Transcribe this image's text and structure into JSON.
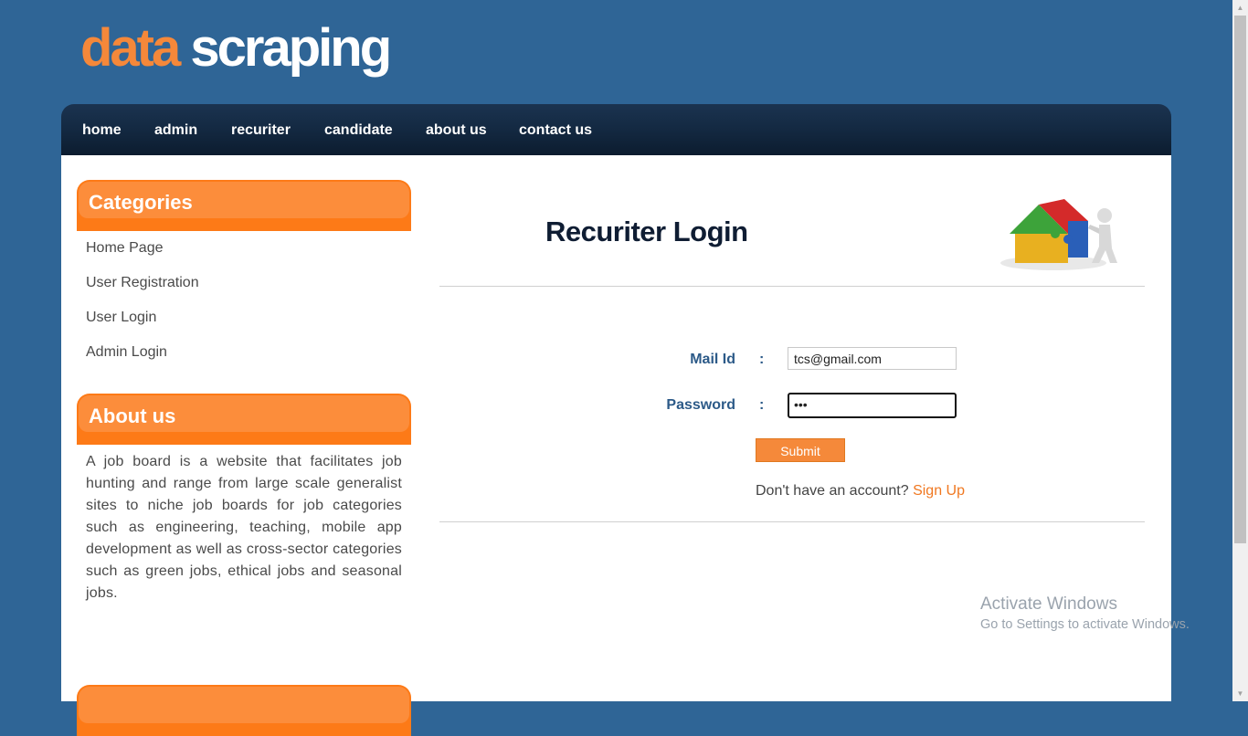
{
  "logo": {
    "word1": "data",
    "word2": "scraping"
  },
  "nav": [
    "home",
    "admin",
    "recuriter",
    "candidate",
    "about us",
    "contact us"
  ],
  "sidebar": {
    "categories_title": "Categories",
    "categories": [
      "Home Page",
      "User Registration",
      "User Login",
      "Admin Login"
    ],
    "about_title": "About us",
    "about_text": "A job board is a website that facilitates job hunting and range from large scale generalist sites to niche job boards for job categories such as engineering, teaching, mobile app development as well as cross-sector categories such as green jobs, ethical jobs and seasonal jobs."
  },
  "main": {
    "title": "Recuriter Login",
    "illustration": "puzzle-house-figure-icon",
    "form": {
      "mail_label": "Mail Id",
      "password_label": "Password",
      "colon": ":",
      "mail_value": "tcs@gmail.com",
      "password_mask": "•••",
      "submit_label": "Submit"
    },
    "signup_prompt": "Don't have an account?",
    "signup_link": "Sign Up"
  },
  "watermark": {
    "title": "Activate Windows",
    "subtitle": "Go to Settings to activate Windows."
  },
  "colors": {
    "background": "#2f6596",
    "accent": "#fd7a17",
    "nav": "#142a43"
  }
}
